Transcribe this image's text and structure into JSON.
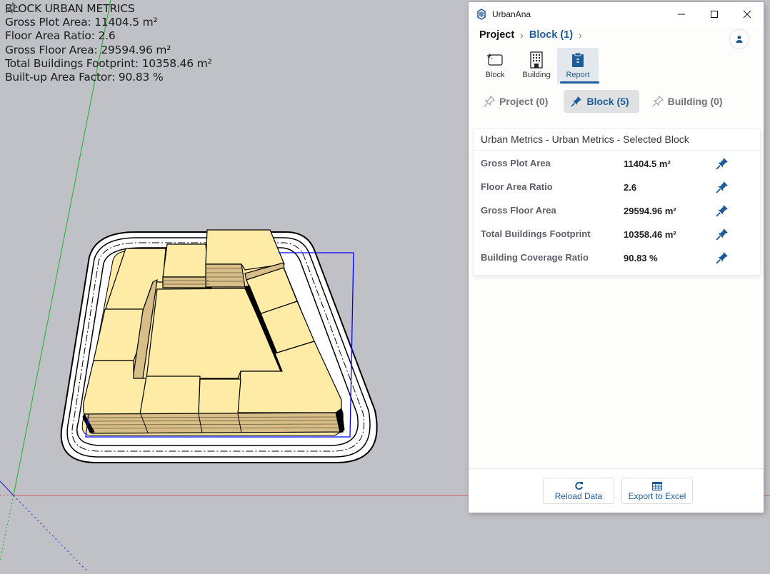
{
  "viewport": {
    "overlay": {
      "title": "BLOCK URBAN METRICS",
      "lines": [
        "Gross Plot Area: 11404.5 m²",
        "Floor Area Ratio: 2.6",
        "Gross Floor Area: 29594.96 m²",
        "Total Buildings Footprint: 10358.46 m²",
        "Built-up Area Factor: 90.83 %"
      ]
    },
    "colors": {
      "background": "#c0c1c6",
      "building_top": "#fdeba6",
      "building_side": "#d7bd87",
      "axis_red": "#c8383a",
      "axis_green": "#1fae2a",
      "axis_blue": "#1b1bd6",
      "selection": "#0000ff"
    }
  },
  "window": {
    "title": "UrbanAna",
    "controls": {
      "minimize": "minimize",
      "maximize": "maximize",
      "close": "close"
    },
    "breadcrumb": {
      "project": "Project",
      "block": "Block (1)"
    },
    "nav_tabs": [
      {
        "label": "Block",
        "icon": "block-add-icon",
        "active": false
      },
      {
        "label": "Building",
        "icon": "building-icon",
        "active": false
      },
      {
        "label": "Report",
        "icon": "clipboard-icon",
        "active": true
      }
    ],
    "pin_tabs": [
      {
        "label": "Project (0)",
        "active": false
      },
      {
        "label": "Block (5)",
        "active": true
      },
      {
        "label": "Building (0)",
        "active": false
      }
    ],
    "card": {
      "title": "Urban Metrics - Urban Metrics - Selected Block",
      "metrics": [
        {
          "label": "Gross Plot Area",
          "value": "11404.5 m²"
        },
        {
          "label": "Floor Area Ratio",
          "value": "2.6"
        },
        {
          "label": "Gross Floor Area",
          "value": "29594.96 m²"
        },
        {
          "label": "Total Buildings Footprint",
          "value": "10358.46 m²"
        },
        {
          "label": "Building Coverage Ratio",
          "value": "90.83 %"
        }
      ]
    },
    "footer": {
      "reload_label": "Reload Data",
      "export_label": "Export to Excel"
    },
    "accent_color": "#1c5d99"
  }
}
